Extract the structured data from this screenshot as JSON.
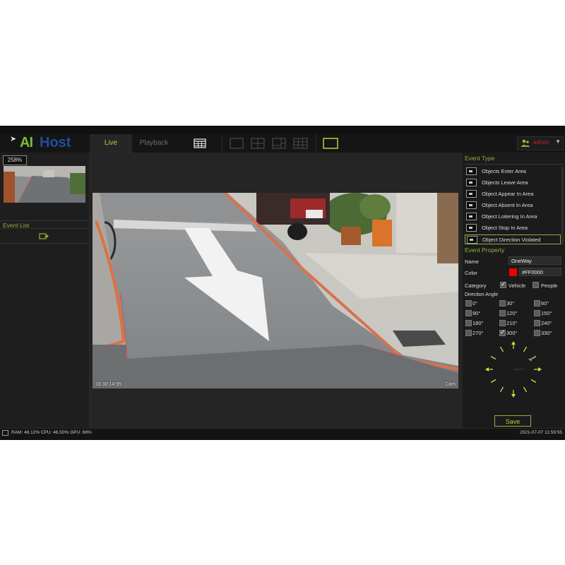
{
  "app": {
    "logo_prefix": "AI",
    "logo_rest": "Host"
  },
  "tabs": {
    "live": "Live",
    "playback": "Playback"
  },
  "user": {
    "name": "admin"
  },
  "left_panel": {
    "zoom": "258%",
    "event_list_title": "Event List"
  },
  "video": {
    "timestamp": "18:30:14:95",
    "camera_label": "Cam"
  },
  "event_type": {
    "title": "Event Type",
    "items": [
      "Objects Enter Area",
      "Objects Leave Area",
      "Object Appear In Area",
      "Object Absent In Area",
      "Object Loitering In Area",
      "Object Stop In Area",
      "Object Direction Violated"
    ],
    "selected_index": 6
  },
  "event_property": {
    "title": "Event Property",
    "name_label": "Name",
    "name_value": "OneWay",
    "color_label": "Color",
    "color_value": "#FF0000",
    "category_label": "Category",
    "category_vehicle": "Vehicle",
    "category_people": "People",
    "vehicle_checked": true,
    "people_checked": false,
    "direction_label": "Direction Angle",
    "angles": [
      "0°",
      "30°",
      "60°",
      "90°",
      "120°",
      "150°",
      "180°",
      "210°",
      "240°",
      "270°",
      "300°",
      "330°"
    ],
    "checked_angles": [
      "300°"
    ]
  },
  "save_label": "Save",
  "status": {
    "resources": "RAM: 48.12% CPU: 46.50% GPU: 68%",
    "datetime": "2021-07-07 11:59:55"
  },
  "colors": {
    "accent": "#8fb33a",
    "admin": "#c22222",
    "zone_line": "#ff0000"
  }
}
